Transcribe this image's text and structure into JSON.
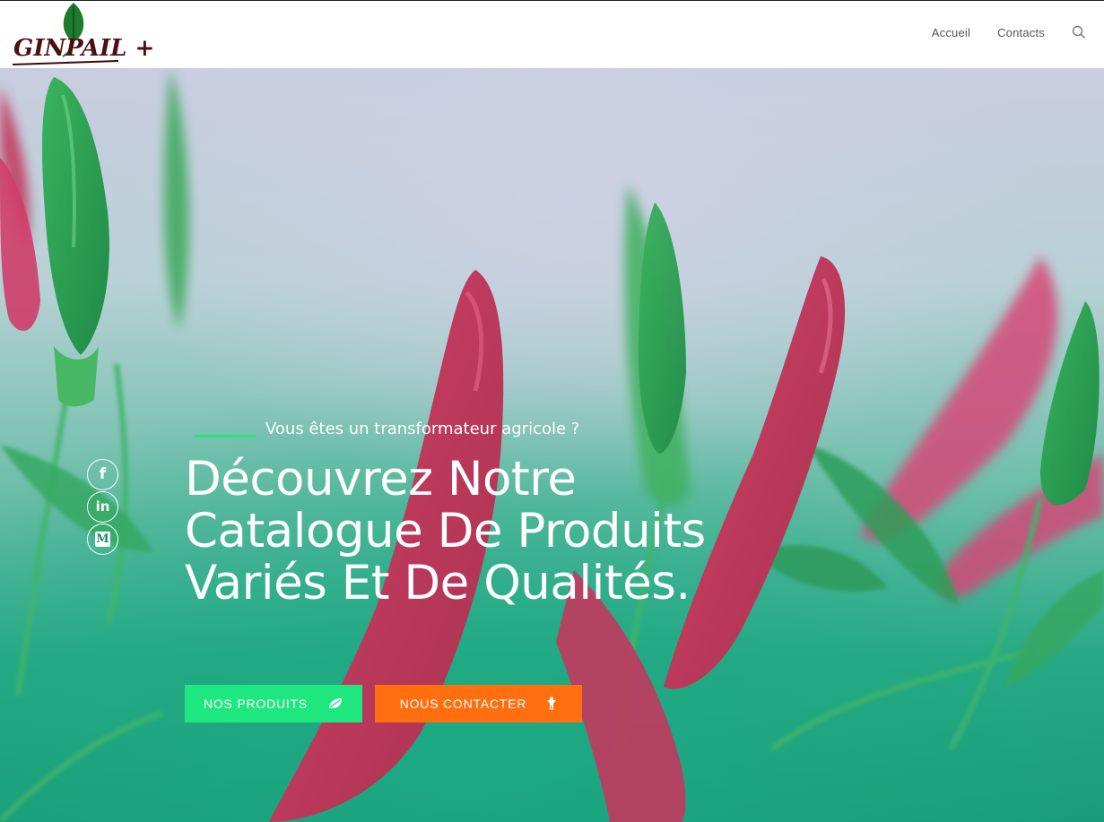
{
  "header": {
    "logo": {
      "text": "GINPAIL +",
      "leaf_color": "#1e7a2c"
    },
    "nav": [
      {
        "label": "Accueil"
      },
      {
        "label": "Contacts"
      }
    ],
    "search_icon": "search-icon"
  },
  "hero": {
    "tagline": "Vous êtes un transformateur agricole ?",
    "headline_lines": [
      "Découvrez Notre",
      "Catalogue De Produits",
      "Variés Et De Qualités."
    ],
    "social": [
      {
        "icon": "facebook-icon",
        "glyph": "f"
      },
      {
        "icon": "linkedin-icon",
        "glyph": "in"
      },
      {
        "icon": "medium-icon",
        "glyph": "M"
      }
    ],
    "buttons": {
      "products": {
        "label": "Nos Produits",
        "icon": "leaf-icon",
        "color": "#1fe77f"
      },
      "contact": {
        "label": "Nous Contacter",
        "icon": "person-icon",
        "color": "#ff6f0f"
      }
    },
    "accent_color": "#2ce07b"
  }
}
